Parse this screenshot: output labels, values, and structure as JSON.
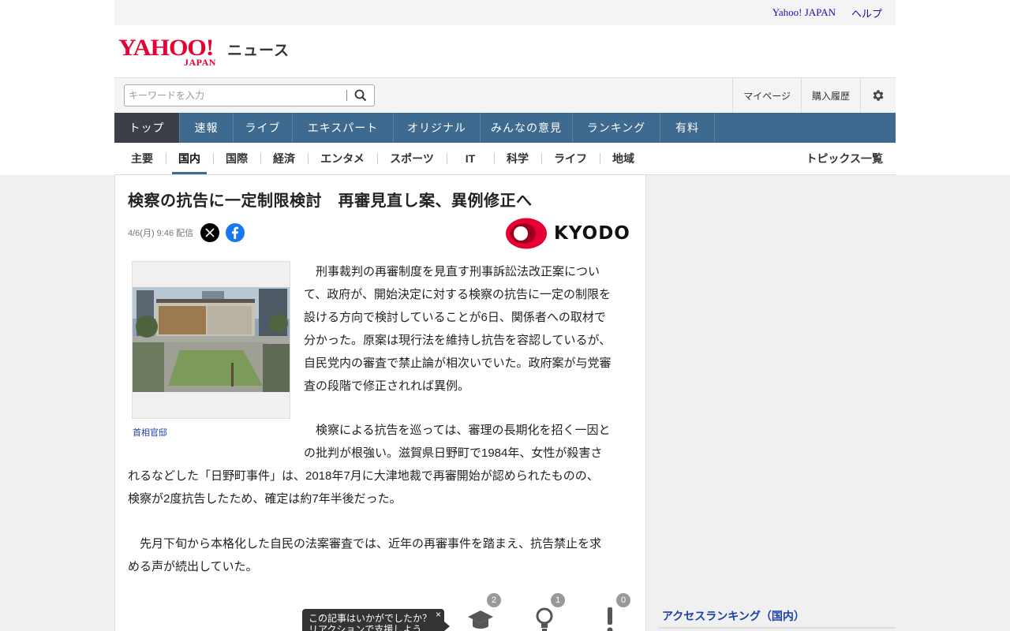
{
  "util": {
    "yahoo_japan": "Yahoo! JAPAN",
    "help": "ヘルプ"
  },
  "logo": {
    "yahoo": "YAHOO!",
    "japan": "JAPAN",
    "news": "ニュース"
  },
  "search": {
    "placeholder": "キーワードを入力",
    "mypage": "マイページ",
    "history": "購入履歴"
  },
  "nav": {
    "items": [
      "トップ",
      "速報",
      "ライブ",
      "エキスパート",
      "オリジナル",
      "みんなの意見",
      "ランキング",
      "有料"
    ],
    "active": "トップ"
  },
  "subnav": {
    "items": [
      "主要",
      "国内",
      "国際",
      "経済",
      "エンタメ",
      "スポーツ",
      "IT",
      "科学",
      "ライフ",
      "地域"
    ],
    "active": "国内",
    "topics": "トピックス一覧"
  },
  "article": {
    "headline": "検察の抗告に一定制限検討　再審見直し案、異例修正へ",
    "date": "4/6(月) 9:46 配信",
    "source": "KYODO",
    "photo_caption": "首相官邸",
    "paragraphs": [
      [
        "　刑事裁判の再審制度を見直す刑事訴訟法改正案につい",
        "て、政府が、開始決定に対する検察の抗告に一定の制限を",
        "設ける方向で検討していることが6日、関係者への取材で",
        "分かった。原案は現行法を維持し抗告を容認しているが、",
        "自民党内の審査で禁止論が相次いでいた。政府案が与党審",
        "査の段階で修正されれば異例。"
      ],
      [
        "　検察による抗告を巡っては、審理の長期化を招く一因と",
        "の批判が根強い。滋賀県日野町で1984年、女性が殺害さ",
        "れるなどした「日野町事件」は、2018年7月に大津地裁で再審開始が認められたものの、",
        "検察が2度抗告したため、確定は約7年半後だった。"
      ],
      [
        "　先月下旬から本格化した自民の法案審査では、近年の再審事件を踏まえ、抗告禁止を求",
        "める声が続出していた。"
      ]
    ]
  },
  "reactions": {
    "tooltip_line1": "この記事はいかがでしたか？",
    "tooltip_line2": "リアクションで支援しよう",
    "close": "×",
    "counts": [
      "2",
      "1",
      "0"
    ]
  },
  "sidebar": {
    "ranking_title": "アクセスランキング（国内）"
  },
  "colors": {
    "nav": "#3e6a8f",
    "nav_active": "#3b3f47",
    "brand_red": "#e60033",
    "link": "#1a3fa8"
  }
}
